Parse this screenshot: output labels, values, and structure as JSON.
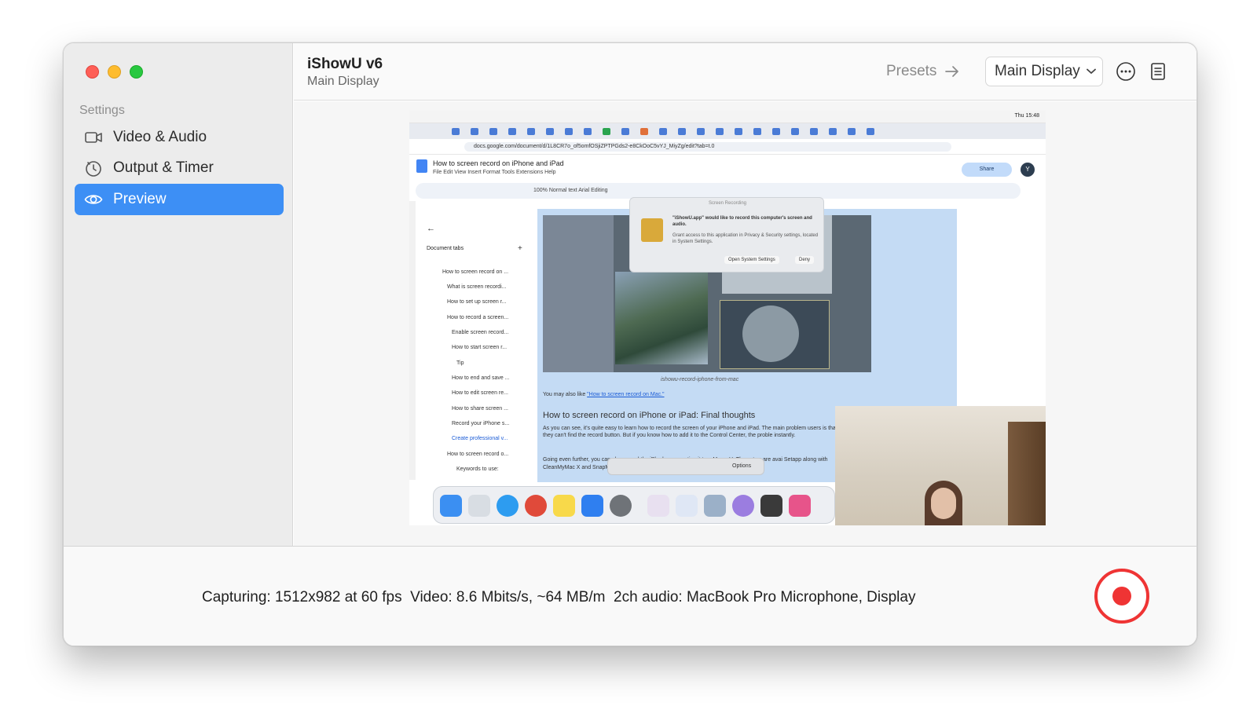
{
  "window": {
    "title": "iShowU v6",
    "subtitle": "Main Display"
  },
  "sidebar": {
    "heading": "Settings",
    "items": [
      {
        "label": "Video & Audio",
        "icon": "video-camera-icon",
        "active": false
      },
      {
        "label": "Output & Timer",
        "icon": "timer-icon",
        "active": false
      },
      {
        "label": "Preview",
        "icon": "eye-icon",
        "active": true
      }
    ]
  },
  "header": {
    "presets_label": "Presets",
    "display_select": "Main Display"
  },
  "preview": {
    "menubar_time": "Thu 15:48",
    "url": "docs.google.com/document/d/1L8CR7o_of5omfOSjiZPTPGds2-e8CkOoC5vYJ_MiyZg/edit?tab=t.0",
    "doc_title": "How to screen record on iPhone and iPad",
    "doc_menu": "File   Edit   View   Insert   Format   Tools   Extensions   Help",
    "share_label": "Share",
    "avatar_letter": "Y",
    "toolbar_text": "100%    Normal text    Arial                                    Editing",
    "doc_tabs_heading": "Document tabs",
    "doc_tabs": [
      "How to screen record on ...",
      "What is screen recordi...",
      "How to set up screen r...",
      "How to record a screen...",
      "Enable screen record...",
      "How to start screen r...",
      "Tip",
      "How to end and save ...",
      "How to edit screen re...",
      "How to share screen ...",
      "Record your iPhone s...",
      "Create professional v...",
      "How to screen record o...",
      "Keywords to use:"
    ],
    "dialog_title": "Screen Recording",
    "dialog_message": "\"iShowU.app\" would like to record this computer's screen and audio.",
    "dialog_sub": "Grant access to this application in Privacy & Security settings, located in System Settings.",
    "dialog_open": "Open System Settings",
    "dialog_deny": "Deny",
    "image_caption": "ishowu-record-iphone-from-mac",
    "may_like_prefix": "You may also like ",
    "may_like_link": "\"How to screen record on Mac.\"",
    "final_heading": "How to screen record on iPhone or iPad: Final thoughts",
    "final_paragraph": "As you can see, it's quite easy to learn how to record the screen of your iPhone and iPad. The main problem users is that they can't find the record button. But if you know how to add it to the Control Center, the proble instantly.",
    "going_paragraph": "Going even further, you                                               can also record the iPho by connecting it to a Ma                                               owU. These two are avai Setapp along with CleanMyMac X and SnapMotion that I've mentioned in this guide.",
    "capture_options": "Options"
  },
  "status": {
    "text": "Capturing: 1512x982 at 60 fps  Video: 8.6 Mbits/s, ~64 MB/m  2ch audio: MacBook Pro Microphone, Display"
  },
  "colors": {
    "accent": "#3d8ff5",
    "record": "#ef3434",
    "traffic_red": "#fe5f57",
    "traffic_yellow": "#febc2e",
    "traffic_green": "#28c840"
  }
}
